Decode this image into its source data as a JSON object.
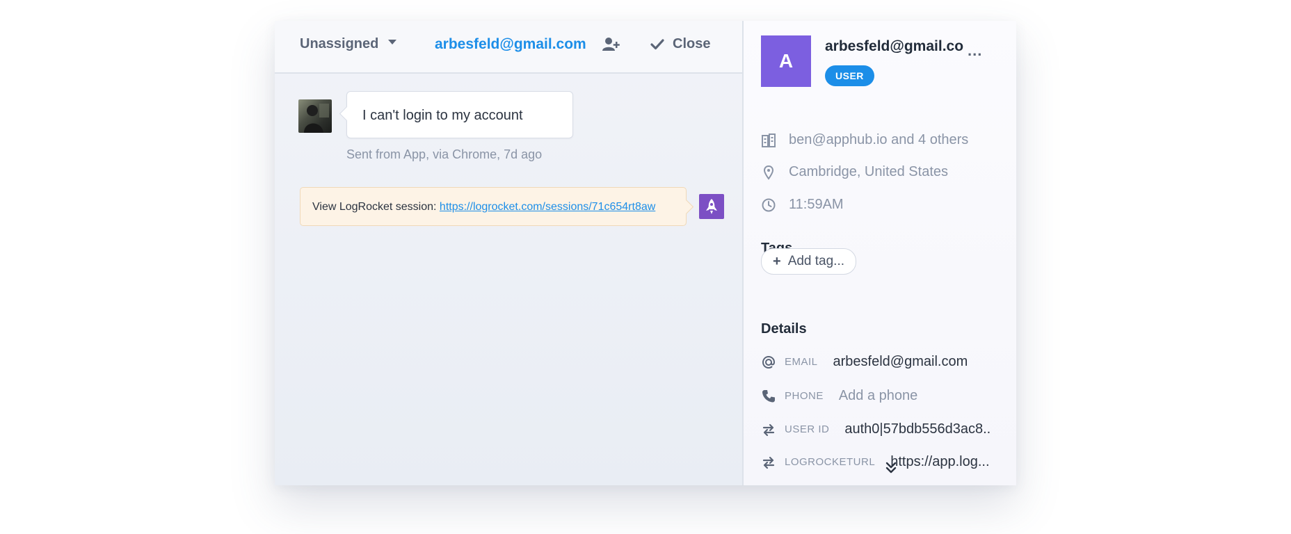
{
  "conversation": {
    "header": {
      "assignee_label": "Unassigned",
      "customer_email": "arbesfeld@gmail.com",
      "close_label": "Close"
    },
    "message": {
      "text": "I can't login to my account",
      "meta": "Sent from App, via Chrome, 7d ago"
    },
    "note": {
      "prefix": "View LogRocket session:",
      "link": "https://logrocket.com/sessions/71c654rt8aw"
    }
  },
  "profile": {
    "avatar_letter": "A",
    "name": "arbesfeld@gmail.co",
    "role_badge": "USER",
    "more_label": "...",
    "company": "ben@apphub.io and 4 others",
    "location": "Cambridge, United States",
    "local_time": "11:59AM",
    "tags_title": "Tags",
    "add_tag_label": "Add tag...",
    "details_title": "Details",
    "details": {
      "email_label": "EMAIL",
      "email_value": "arbesfeld@gmail.com",
      "phone_label": "PHONE",
      "phone_placeholder": "Add a phone",
      "user_id_label": "USER ID",
      "user_id_value": "auth0|57bdb556d3ac8..",
      "logrocket_label": "LOGROCKETURL",
      "logrocket_value": "https://app.log..."
    }
  },
  "colors": {
    "accent_blue": "#1c8ee8",
    "avatar_purple": "#7c5fe0",
    "note_background": "#fdf3e6",
    "rocket_purple": "#7c4fc4"
  },
  "icons": [
    "chevron-down-icon",
    "add-user-icon",
    "check-icon",
    "rocket-icon",
    "building-icon",
    "location-pin-icon",
    "clock-icon",
    "plus-icon",
    "at-icon",
    "phone-icon",
    "swap-icon",
    "double-chevron-down-icon"
  ]
}
